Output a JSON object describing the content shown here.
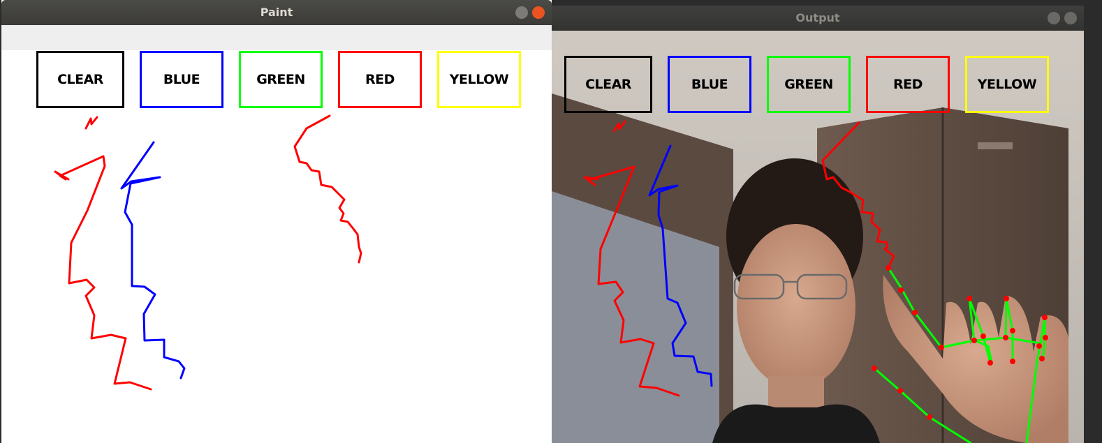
{
  "paint_window": {
    "title": "Paint",
    "buttons": [
      {
        "label": "CLEAR",
        "color": "#000000"
      },
      {
        "label": "BLUE",
        "color": "#0000ff"
      },
      {
        "label": "GREEN",
        "color": "#00ff00"
      },
      {
        "label": "RED",
        "color": "#ff0000"
      },
      {
        "label": "YELLOW",
        "color": "#ffff00"
      }
    ]
  },
  "output_window": {
    "title": "Output",
    "buttons": [
      {
        "label": "CLEAR",
        "color": "#000000"
      },
      {
        "label": "BLUE",
        "color": "#0000ff"
      },
      {
        "label": "GREEN",
        "color": "#00ff00"
      },
      {
        "label": "RED",
        "color": "#ff0000"
      },
      {
        "label": "YELLOW",
        "color": "#ffff00"
      }
    ]
  },
  "stroke_colors": {
    "red": "#ff0000",
    "blue": "#0000ff",
    "landmark_line": "#00ff00",
    "landmark_point": "#ff0000"
  }
}
